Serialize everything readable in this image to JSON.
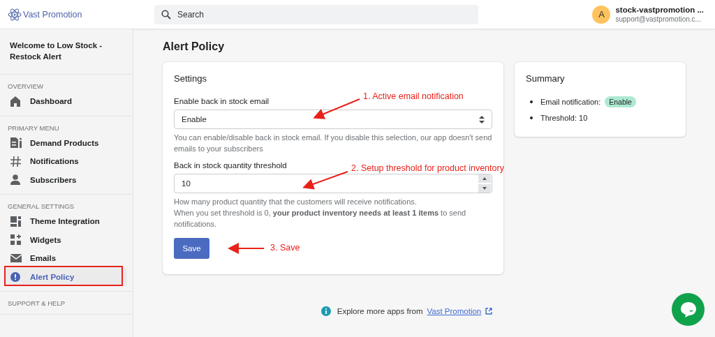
{
  "header": {
    "logo": "Vast Promotion",
    "search": {
      "placeholder": "Search"
    },
    "user": {
      "avatar": "A",
      "name": "stock-vastpromotion ...",
      "email": "support@vastpromotion.c..."
    }
  },
  "sidebar": {
    "welcome": "Welcome to Low Stock - Restock Alert",
    "sections": [
      {
        "heading": "OVERVIEW",
        "items": [
          {
            "label": "Dashboard",
            "selected": false,
            "highlighted": false
          }
        ]
      },
      {
        "heading": "PRIMARY MENU",
        "items": [
          {
            "label": "Demand Products",
            "selected": false,
            "highlighted": false
          },
          {
            "label": "Notifications",
            "selected": false,
            "highlighted": false
          },
          {
            "label": "Subscribers",
            "selected": false,
            "highlighted": false
          }
        ]
      },
      {
        "heading": "GENERAL SETTINGS",
        "items": [
          {
            "label": "Theme Integration",
            "selected": false,
            "highlighted": false
          },
          {
            "label": "Widgets",
            "selected": false,
            "highlighted": false
          },
          {
            "label": "Emails",
            "selected": false,
            "highlighted": false
          },
          {
            "label": "Alert Policy",
            "selected": true,
            "highlighted": true
          }
        ]
      },
      {
        "heading": "SUPPORT & HELP"
      }
    ]
  },
  "page_title": "Alert Policy",
  "settings": {
    "title": "Settings",
    "email_select": {
      "label": "Enable back in stock email",
      "value": "Enable",
      "help": "You can enable/disable back in stock email. If you disable this selection, our app doesn't send emails to your subscribers"
    },
    "threshold": {
      "label": "Back in stock quantity threshold",
      "value": "10",
      "help": "How many product quantity that the customers will receive notifications.",
      "help_2": "When you set threshold is 0, **your product inventory needs at least 1 items** to send notifications."
    },
    "save": "Save"
  },
  "summary": {
    "title": "Summary",
    "items": [
      {
        "label": "Email notification:",
        "badge": "Enable"
      },
      {
        "label": "Threshold: 10"
      }
    ]
  },
  "footer": {
    "text": "Explore more apps from",
    "link": "Vast Promotion"
  },
  "annotations": [
    {
      "text": "1. Active email notification"
    },
    {
      "text": "2. Setup threshold for product inventory"
    },
    {
      "text": "3. Save"
    }
  ]
}
